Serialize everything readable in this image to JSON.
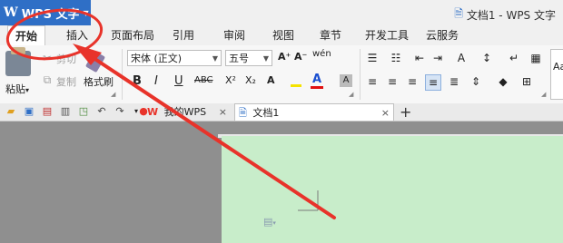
{
  "app": {
    "name": "WPS 文字",
    "window_title": "文档1 - WPS 文字"
  },
  "tabs": [
    "开始",
    "插入",
    "页面布局",
    "引用",
    "审阅",
    "视图",
    "章节",
    "开发工具",
    "云服务"
  ],
  "ribbon": {
    "clipboard": {
      "paste": "粘贴",
      "cut": "剪切",
      "copy": "复制",
      "format_painter": "格式刷"
    },
    "font": {
      "name": "宋体 (正文)",
      "size": "五号",
      "bold": "B",
      "italic": "I",
      "underline": "U",
      "strike": "ABC",
      "superscript": "X²",
      "subscript": "X₂",
      "grow": "A⁺",
      "shrink": "A⁻",
      "font_color": "A",
      "clear": "A"
    },
    "phonetic": "wén",
    "styles_preview": "Aa"
  },
  "doc_tabs": [
    {
      "label": "我的WPS"
    },
    {
      "label": "文档1"
    }
  ],
  "colors": {
    "brand_blue": "#2f6fc6",
    "annotation_red": "#e8332a",
    "page_green": "#c8edca",
    "workspace_gray": "#8f8f8f"
  }
}
